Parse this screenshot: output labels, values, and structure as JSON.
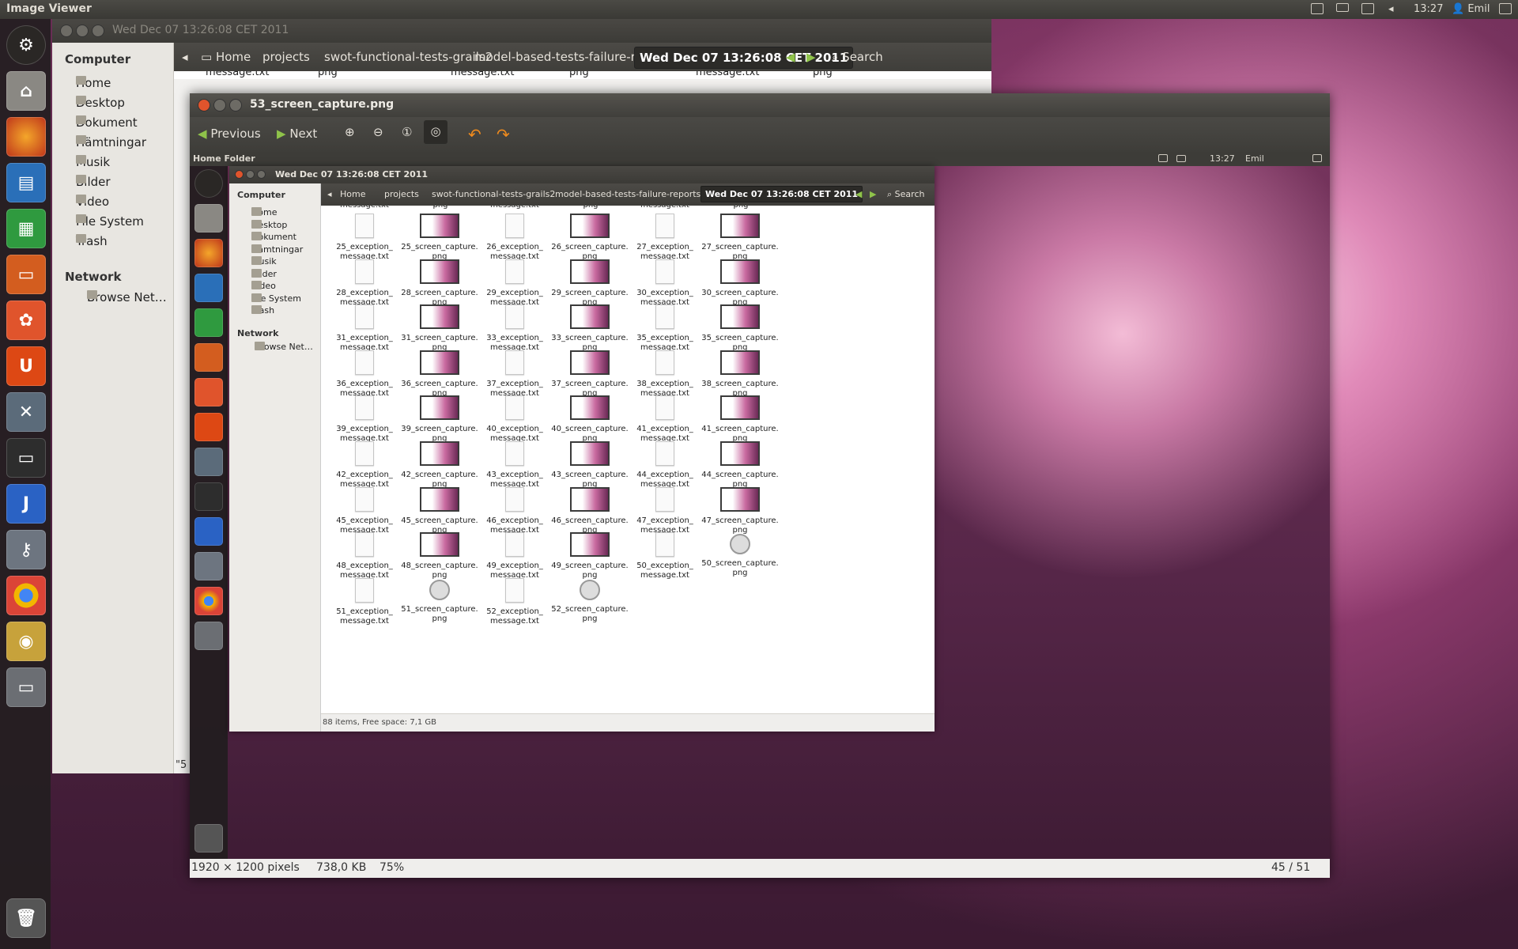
{
  "topbar": {
    "app_title": "Image Viewer",
    "time": "13:27",
    "user": "Emil"
  },
  "launcher": {
    "items": [
      "ubuntu-logo",
      "home-folder",
      "firefox",
      "writer",
      "calc",
      "impress",
      "ubuntu-software",
      "ubuntu-one",
      "system-settings",
      "terminal",
      "intellij",
      "keys",
      "chrome",
      "disk-utility",
      "workspaces"
    ]
  },
  "nautilus_back": {
    "title": "Wed Dec 07 13:26:08 CET 2011",
    "sidebar": {
      "computer_header": "Computer",
      "items": [
        "Home",
        "Desktop",
        "Dokument",
        "Hämtningar",
        "Musik",
        "Bilder",
        "Video",
        "File System",
        "Trash"
      ],
      "network_header": "Network",
      "network_items": [
        "Browse Net…"
      ]
    },
    "breadcrumbs": [
      "Home",
      "projects",
      "swot-functional-tests-grails2",
      "model-based-tests-failure-reports",
      "Wed Dec 07 13:26:08 CET 2011"
    ],
    "search_label": "Search",
    "partial_labels": [
      "message.txt",
      "png",
      "message.txt",
      "png",
      "message.txt",
      "png"
    ],
    "clipped_text": "\"5"
  },
  "viewer": {
    "title": "53_screen_capture.png",
    "prev_label": "Previous",
    "next_label": "Next",
    "status": {
      "dimensions": "1920 × 1200 pixels",
      "size": "738,0 KB",
      "zoom": "75%",
      "position": "45 / 51"
    }
  },
  "inner": {
    "app_title": "Home Folder",
    "time": "13:27",
    "user": "Emil",
    "window_title": "Wed Dec 07 13:26:08 CET 2011",
    "sidebar": {
      "computer_header": "Computer",
      "items": [
        "Home",
        "Desktop",
        "Dokument",
        "Hämtningar",
        "Musik",
        "Bilder",
        "Video",
        "File System",
        "Trash"
      ],
      "network_header": "Network",
      "network_items": [
        "Browse Net…"
      ]
    },
    "breadcrumbs": [
      "Home",
      "projects",
      "swot-functional-tests-grails2",
      "model-based-tests-failure-reports",
      "Wed Dec 07 13:26:08 CET 2011"
    ],
    "search_label": "Search",
    "partial_labels": [
      "message.txt",
      "png",
      "message.txt",
      "png",
      "message.txt",
      "png"
    ],
    "files": [
      [
        "25_exception_",
        "message.txt",
        "txt"
      ],
      [
        "25_screen_capture.",
        "png",
        "png"
      ],
      [
        "26_exception_",
        "message.txt",
        "txt"
      ],
      [
        "26_screen_capture.",
        "png",
        "png"
      ],
      [
        "27_exception_",
        "message.txt",
        "txt"
      ],
      [
        "27_screen_capture.",
        "png",
        "png"
      ],
      [
        "28_exception_",
        "message.txt",
        "txt"
      ],
      [
        "28_screen_capture.",
        "png",
        "png"
      ],
      [
        "29_exception_",
        "message.txt",
        "txt"
      ],
      [
        "29_screen_capture.",
        "png",
        "png"
      ],
      [
        "30_exception_",
        "message.txt",
        "txt"
      ],
      [
        "30_screen_capture.",
        "png",
        "png"
      ],
      [
        "31_exception_",
        "message.txt",
        "txt"
      ],
      [
        "31_screen_capture.",
        "png",
        "png"
      ],
      [
        "33_exception_",
        "message.txt",
        "txt"
      ],
      [
        "33_screen_capture.",
        "png",
        "png"
      ],
      [
        "35_exception_",
        "message.txt",
        "txt"
      ],
      [
        "35_screen_capture.",
        "png",
        "png"
      ],
      [
        "36_exception_",
        "message.txt",
        "txt"
      ],
      [
        "36_screen_capture.",
        "png",
        "png"
      ],
      [
        "37_exception_",
        "message.txt",
        "txt"
      ],
      [
        "37_screen_capture.",
        "png",
        "png"
      ],
      [
        "38_exception_",
        "message.txt",
        "txt"
      ],
      [
        "38_screen_capture.",
        "png",
        "png"
      ],
      [
        "39_exception_",
        "message.txt",
        "txt"
      ],
      [
        "39_screen_capture.",
        "png",
        "png"
      ],
      [
        "40_exception_",
        "message.txt",
        "txt"
      ],
      [
        "40_screen_capture.",
        "png",
        "png"
      ],
      [
        "41_exception_",
        "message.txt",
        "txt"
      ],
      [
        "41_screen_capture.",
        "png",
        "png"
      ],
      [
        "42_exception_",
        "message.txt",
        "txt"
      ],
      [
        "42_screen_capture.",
        "png",
        "png"
      ],
      [
        "43_exception_",
        "message.txt",
        "txt"
      ],
      [
        "43_screen_capture.",
        "png",
        "png"
      ],
      [
        "44_exception_",
        "message.txt",
        "txt"
      ],
      [
        "44_screen_capture.",
        "png",
        "png"
      ],
      [
        "45_exception_",
        "message.txt",
        "txt"
      ],
      [
        "45_screen_capture.",
        "png",
        "png"
      ],
      [
        "46_exception_",
        "message.txt",
        "txt"
      ],
      [
        "46_screen_capture.",
        "png",
        "png"
      ],
      [
        "47_exception_",
        "message.txt",
        "txt"
      ],
      [
        "47_screen_capture.",
        "png",
        "png"
      ],
      [
        "48_exception_",
        "message.txt",
        "txt"
      ],
      [
        "48_screen_capture.",
        "png",
        "png"
      ],
      [
        "49_exception_",
        "message.txt",
        "txt"
      ],
      [
        "49_screen_capture.",
        "png",
        "png"
      ],
      [
        "50_exception_",
        "message.txt",
        "txt"
      ],
      [
        "50_screen_capture.",
        "png",
        "movie"
      ],
      [
        "51_exception_",
        "message.txt",
        "txt"
      ],
      [
        "51_screen_capture.",
        "png",
        "movie"
      ],
      [
        "52_exception_",
        "message.txt",
        "txt"
      ],
      [
        "52_screen_capture.",
        "png",
        "movie"
      ]
    ],
    "status": "88 items, Free space: 7,1 GB"
  },
  "colors": {
    "close_button": "#e0542c",
    "accent_orange": "#dd4814",
    "window_chrome": "#3c3b37"
  }
}
